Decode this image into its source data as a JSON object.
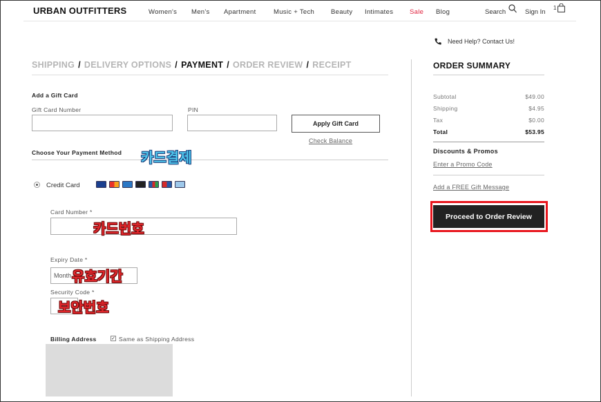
{
  "header": {
    "logo": "URBAN OUTFITTERS",
    "nav": [
      "Women's",
      "Men's",
      "Apartment",
      "Music + Tech",
      "Beauty",
      "Intimates",
      "Sale",
      "Blog"
    ],
    "search_label": "Search",
    "sign_in": "Sign In",
    "cart_count": "1"
  },
  "help": {
    "text": "Need Help? Contact Us!"
  },
  "steps": [
    {
      "label": "SHIPPING",
      "active": false
    },
    {
      "label": "DELIVERY OPTIONS",
      "active": false
    },
    {
      "label": "PAYMENT",
      "active": true
    },
    {
      "label": "ORDER REVIEW",
      "active": false
    },
    {
      "label": "RECEIPT",
      "active": false
    }
  ],
  "gift_card": {
    "title": "Add a Gift Card",
    "number_label": "Gift Card Number",
    "pin_label": "PIN",
    "apply_button": "Apply Gift Card",
    "check_balance": "Check Balance"
  },
  "payment": {
    "title": "Choose Your Payment Method",
    "credit_card_label": "Credit Card",
    "card_number_label": "Card Number *",
    "expiry_label": "Expiry Date *",
    "expiry_value": "Month",
    "security_label": "Security Code *",
    "billing_label": "Billing Address",
    "same_as_shipping": "Same as Shipping Address"
  },
  "annotations": {
    "card_payment": "카드결제",
    "card_number": "카드번호",
    "expiry": "유효기간",
    "security": "보안번호"
  },
  "order_summary": {
    "title": "ORDER SUMMARY",
    "rows": [
      {
        "label": "Subtotal",
        "value": "$49.00"
      },
      {
        "label": "Shipping",
        "value": "$4.95"
      },
      {
        "label": "Tax",
        "value": "$0.00"
      },
      {
        "label": "Total",
        "value": "$53.95"
      }
    ],
    "promos_title": "Discounts & Promos",
    "promo_link": "Enter a Promo Code",
    "gift_message_link": "Add a FREE Gift Message",
    "proceed_button": "Proceed to Order Review"
  },
  "colors": {
    "sale": "#e0203c",
    "highlight_border": "#e8141c",
    "proceed_bg": "#222222"
  }
}
